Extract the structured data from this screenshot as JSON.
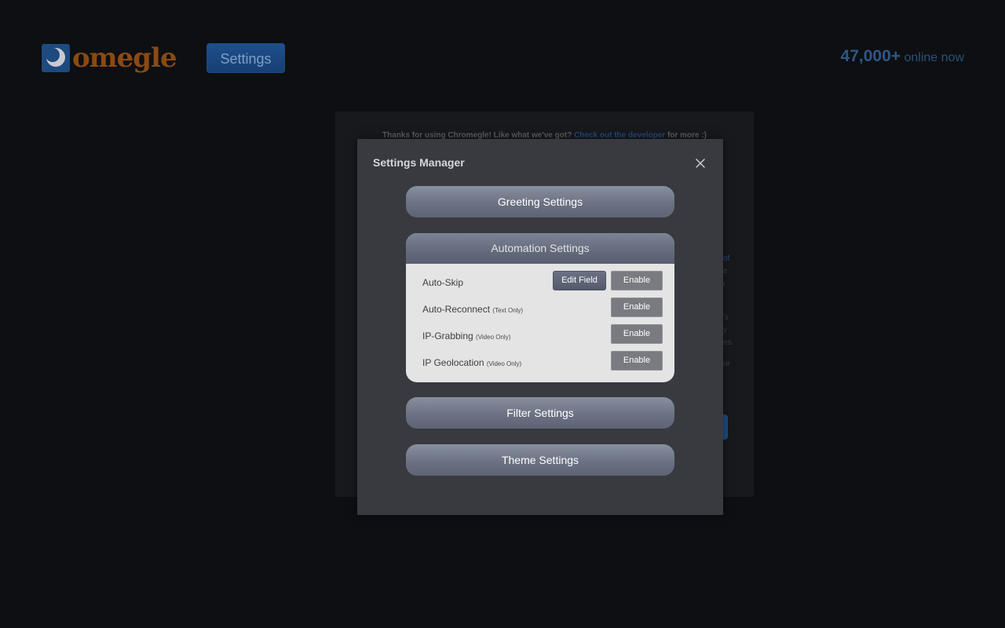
{
  "header": {
    "logo_text": "omegle",
    "settings_button": "Settings",
    "online_count": "47,000+",
    "online_suffix": " online now"
  },
  "background": {
    "notice_prefix": "Thanks for using Chromegle! Like what we've got? ",
    "notice_link": "Check out the developer",
    "notice_suffix": " for more :)",
    "fragments": [
      "of",
      "e",
      "r",
      "'s",
      "y",
      "es.",
      "or"
    ]
  },
  "modal": {
    "title": "Settings Manager",
    "sections": {
      "greeting": "Greeting Settings",
      "automation": "Automation Settings",
      "filter": "Filter Settings",
      "theme": "Theme Settings"
    },
    "automation_rows": [
      {
        "label": "Auto-Skip",
        "note": "",
        "edit_label": "Edit Field",
        "enable_label": "Enable"
      },
      {
        "label": "Auto-Reconnect",
        "note": "(Text Only)",
        "enable_label": "Enable"
      },
      {
        "label": "IP-Grabbing",
        "note": "(Video Only)",
        "enable_label": "Enable"
      },
      {
        "label": "IP Geolocation",
        "note": "(Video Only)",
        "enable_label": "Enable"
      }
    ]
  },
  "icons": {
    "logo": "omegle-logo-icon",
    "close": "close-icon"
  },
  "colors": {
    "page_bg": "#0d0f12",
    "modal_bg": "#393a3f",
    "accent_blue": "#1f4f8c",
    "logo_orange": "#8a4a14",
    "section_button": "#6b7283",
    "panel_bg": "#e4e4e4",
    "enable_button": "#7a7b80"
  }
}
